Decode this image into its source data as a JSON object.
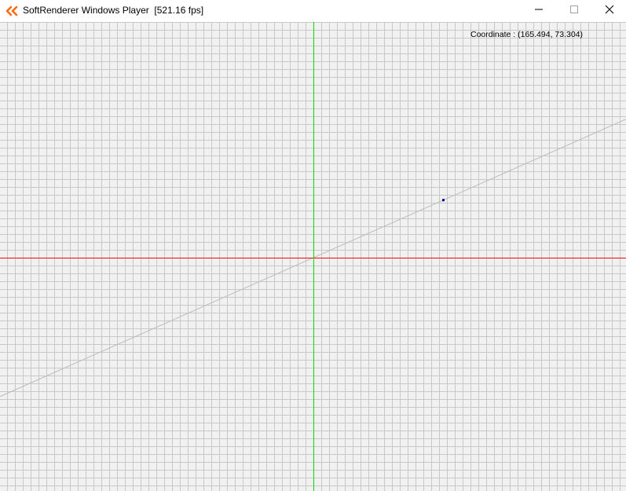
{
  "window": {
    "title": "SoftRenderer Windows Player  [521.16 fps]",
    "icon": "softrenderer-logo-icon",
    "controls": {
      "minimize_icon": "minimize-icon",
      "maximize_icon": "maximize-icon",
      "close_icon": "close-icon"
    }
  },
  "viewport": {
    "coordinate_text": "Coordinate : (165.494, 73.304)",
    "point": {
      "x": 165.494,
      "y": 73.304
    },
    "grid": true,
    "colors": {
      "background": "#f1f1f1",
      "grid_line": "#c8c8c8",
      "x_axis": "#ff0000",
      "y_axis": "#00dd00",
      "guide_line": "#bdbdbd",
      "point": "#00008b",
      "logo": "#ff6a13"
    }
  }
}
